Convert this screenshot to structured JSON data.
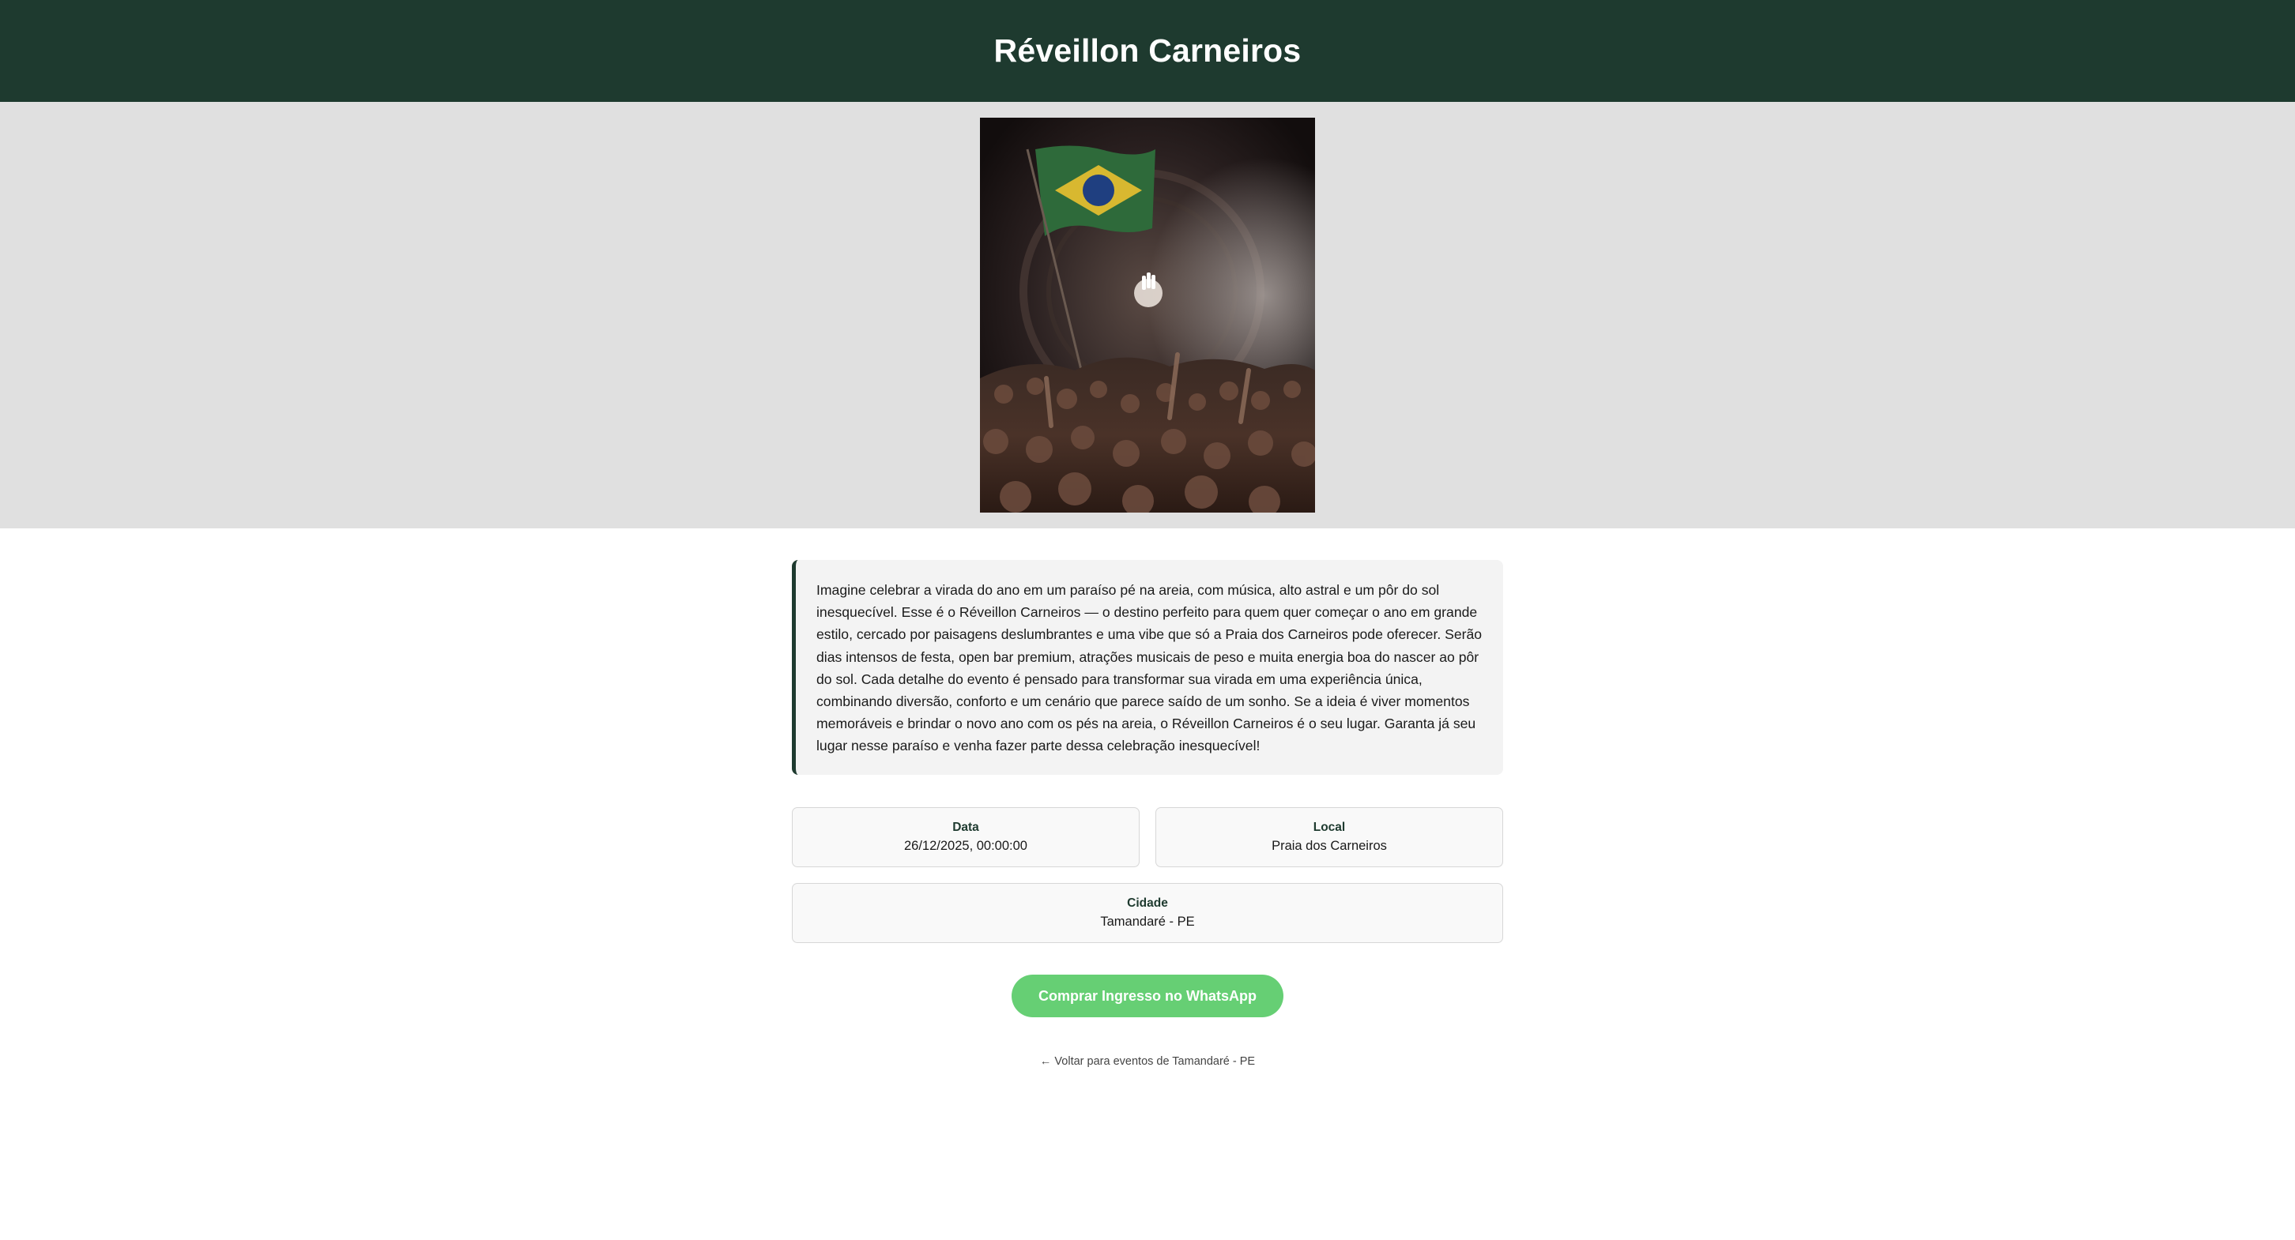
{
  "header": {
    "title": "Réveillon Carneiros"
  },
  "hero": {
    "image_alt": "Multidão em festa com bandeira do Brasil"
  },
  "event": {
    "description": "Imagine celebrar a virada do ano em um paraíso pé na areia, com música, alto astral e um pôr do sol inesquecível. Esse é o Réveillon Carneiros — o destino perfeito para quem quer começar o ano em grande estilo, cercado por paisagens deslumbrantes e uma vibe que só a Praia dos Carneiros pode oferecer. Serão dias intensos de festa, open bar premium, atrações musicais de peso e muita energia boa do nascer ao pôr do sol. Cada detalhe do evento é pensado para transformar sua virada em uma experiência única, combinando diversão, conforto e um cenário que parece saído de um sonho. Se a ideia é viver momentos memoráveis e brindar o novo ano com os pés na areia, o Réveillon Carneiros é o seu lugar. Garanta já seu lugar nesse paraíso e venha fazer parte dessa celebração inesquecível!",
    "date_label": "Data",
    "date_value": "26/12/2025, 00:00:00",
    "location_label": "Local",
    "location_value": "Praia dos Carneiros",
    "city_label": "Cidade",
    "city_value": "Tamandaré - PE"
  },
  "actions": {
    "buy_label": "Comprar Ingresso no WhatsApp",
    "back_label": "← Voltar para eventos de Tamandaré - PE"
  },
  "colors": {
    "header_bg": "#1e3a2f",
    "hero_bg": "#e0e0e0",
    "accent_border": "#1e3a2f",
    "button_bg": "#66cf74"
  }
}
